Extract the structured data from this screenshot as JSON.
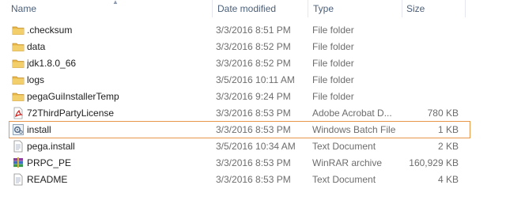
{
  "columns": {
    "name": "Name",
    "date": "Date modified",
    "type": "Type",
    "size": "Size"
  },
  "rows": [
    {
      "name": ".checksum",
      "date": "3/3/2016 8:51 PM",
      "type": "File folder",
      "size": "",
      "icon": "folder-icon"
    },
    {
      "name": "data",
      "date": "3/3/2016 8:52 PM",
      "type": "File folder",
      "size": "",
      "icon": "folder-icon"
    },
    {
      "name": "jdk1.8.0_66",
      "date": "3/3/2016 8:52 PM",
      "type": "File folder",
      "size": "",
      "icon": "folder-icon"
    },
    {
      "name": "logs",
      "date": "3/5/2016 10:11 AM",
      "type": "File folder",
      "size": "",
      "icon": "folder-icon"
    },
    {
      "name": "pegaGuiInstallerTemp",
      "date": "3/3/2016 9:24 PM",
      "type": "File folder",
      "size": "",
      "icon": "folder-icon"
    },
    {
      "name": "72ThirdPartyLicense",
      "date": "3/3/2016 8:53 PM",
      "type": "Adobe Acrobat D...",
      "size": "780 KB",
      "icon": "pdf-icon"
    },
    {
      "name": "install",
      "date": "3/3/2016 8:53 PM",
      "type": "Windows Batch File",
      "size": "1 KB",
      "icon": "batch-file-icon",
      "selected": true
    },
    {
      "name": "pega.install",
      "date": "3/5/2016 10:34 AM",
      "type": "Text Document",
      "size": "2 KB",
      "icon": "text-document-icon"
    },
    {
      "name": "PRPC_PE",
      "date": "3/3/2016 8:53 PM",
      "type": "WinRAR archive",
      "size": "160,929 KB",
      "icon": "winrar-archive-icon"
    },
    {
      "name": "README",
      "date": "3/3/2016 8:53 PM",
      "type": "Text Document",
      "size": "4 KB",
      "icon": "text-document-icon"
    }
  ],
  "colors": {
    "folder": "#e8b84a",
    "selection_border": "#e8964a",
    "header_text": "#4c607a"
  }
}
